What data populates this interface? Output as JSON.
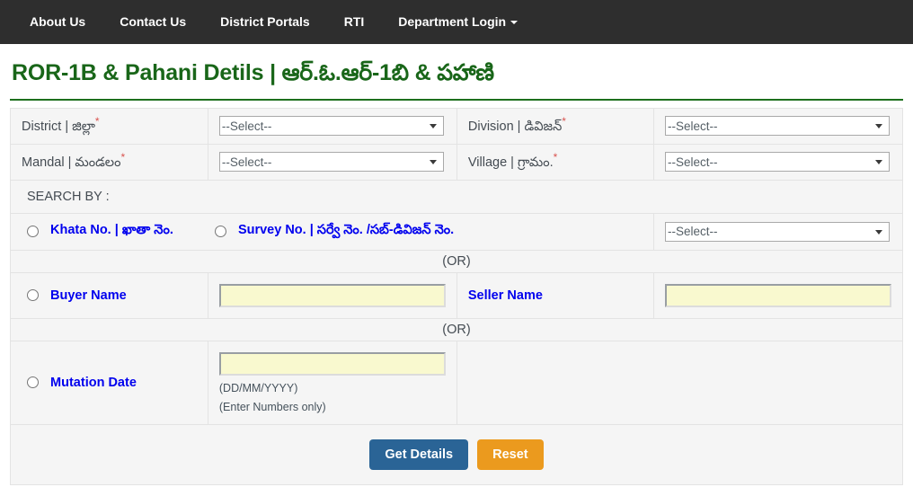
{
  "navbar": {
    "items": [
      {
        "label": "About Us",
        "name": "nav-about-us"
      },
      {
        "label": "Contact Us",
        "name": "nav-contact-us"
      },
      {
        "label": "District Portals",
        "name": "nav-district-portals"
      },
      {
        "label": "RTI",
        "name": "nav-rti"
      },
      {
        "label": "Department Login",
        "name": "nav-department-login",
        "caret": true
      }
    ]
  },
  "page": {
    "title": "ROR-1B & Pahani Detils | ఆర్.ఓ.ఆర్-1బి & పహాణి",
    "title_color": "#196619"
  },
  "form": {
    "district": {
      "label": "District | జిల్లా",
      "required": "*",
      "select_value": "--Select--"
    },
    "division": {
      "label": "Division | డివిజన్",
      "required": "*",
      "select_value": "--Select--"
    },
    "mandal": {
      "label": "Mandal | మండలం",
      "required": "*",
      "select_value": "--Select--"
    },
    "village": {
      "label": "Village | గ్రామం.",
      "required": "*",
      "select_value": "--Select--"
    },
    "search_by_label": "SEARCH BY :",
    "khata": {
      "label": "Khata No. | ఖాతా నెం."
    },
    "survey": {
      "label": "Survey No. | సర్వే నెం. /సబ్-డివిజన్ నెం."
    },
    "khata_survey_select_value": "--Select--",
    "or_1": "(OR)",
    "buyer": {
      "label": "Buyer Name",
      "value": "",
      "placeholder": ""
    },
    "seller": {
      "label": "Seller Name",
      "value": "",
      "placeholder": ""
    },
    "or_2": "(OR)",
    "mutation": {
      "label": "Mutation Date",
      "value": "",
      "placeholder": "",
      "hint_format": "(DD/MM/YYYY)",
      "hint_numbers": "(Enter Numbers only)"
    },
    "buttons": {
      "get_details": "Get Details",
      "reset": "Reset",
      "primary_color": "#2a6496",
      "warning_color": "#eb9a1e"
    }
  }
}
